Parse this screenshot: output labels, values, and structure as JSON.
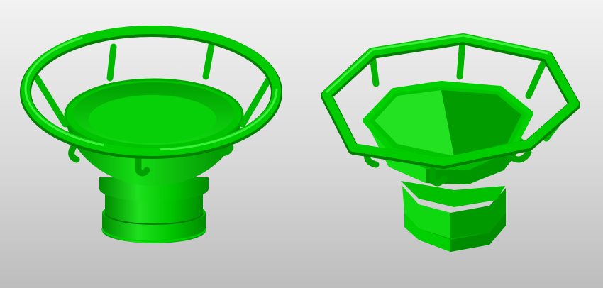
{
  "scene": {
    "background_top": "#f2f2f2",
    "background_bottom": "#bdbdbd"
  },
  "objects": [
    {
      "id": "round-vase",
      "shape": "round",
      "color": "#00c800"
    },
    {
      "id": "octagonal-vase",
      "shape": "octagonal",
      "color": "#00c800"
    }
  ],
  "palette": {
    "light": "#35f035",
    "base": "#00c800",
    "mid": "#00ab00",
    "dark": "#008c00",
    "deep": "#006e00"
  }
}
